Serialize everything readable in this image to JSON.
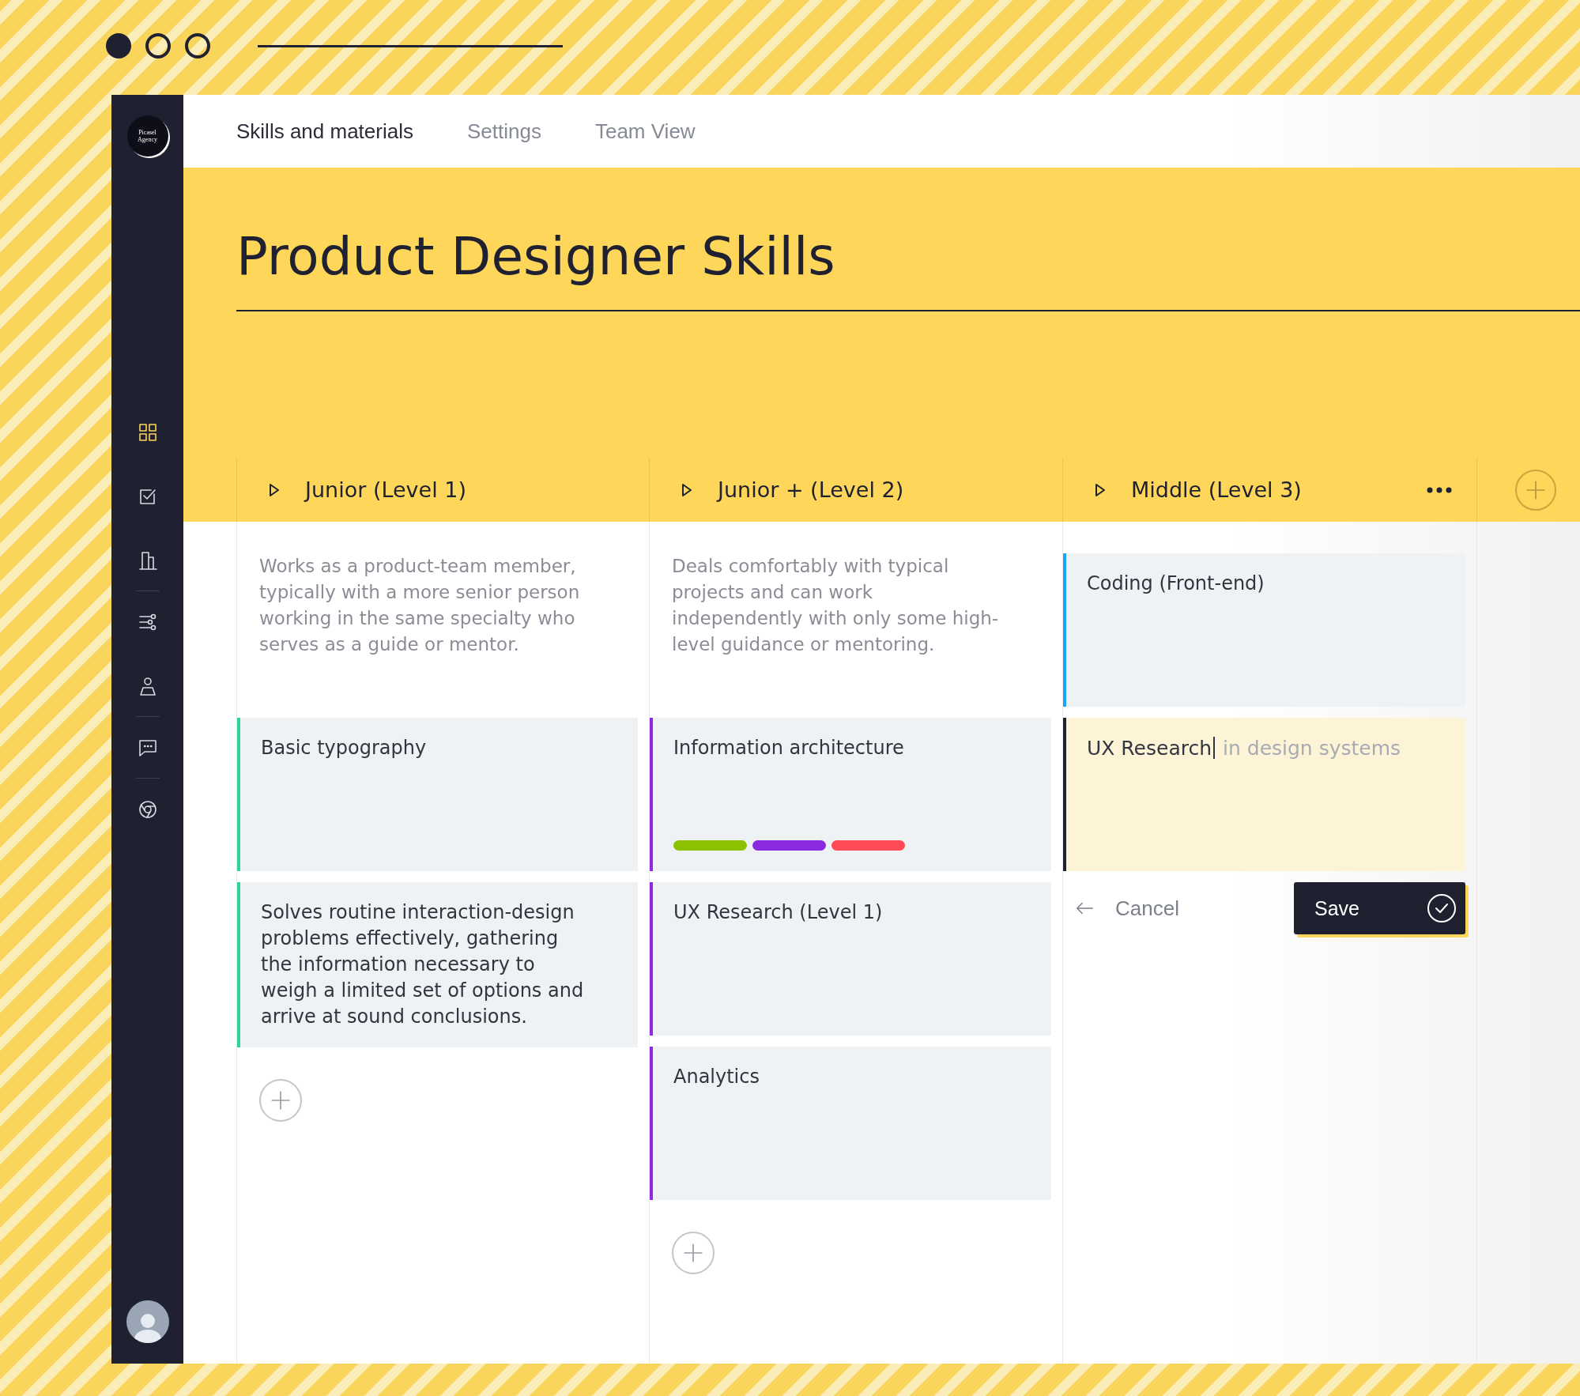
{
  "logo": "Picasel Agency",
  "tabs": [
    {
      "label": "Skills and materials",
      "selected": true
    },
    {
      "label": "Settings",
      "selected": false
    },
    {
      "label": "Team View",
      "selected": false
    }
  ],
  "sidebar": {
    "groups": [
      {
        "items": [
          {
            "selected": true
          },
          {
            "selected": false
          },
          {
            "selected": false
          }
        ]
      },
      {
        "items": [
          {
            "selected": false
          },
          {
            "selected": false
          }
        ]
      },
      {
        "items": [
          {
            "selected": false
          }
        ]
      },
      {
        "items": [
          {
            "selected": false
          }
        ]
      }
    ]
  },
  "title": "Product Designer Skills",
  "columns": [
    {
      "title": "Junior (Level 1)",
      "menu": false,
      "description": "Works as a product-team member, typically with a more senior person working in the same specialty who serves as a guide or mentor.",
      "add_button": true,
      "cards": [
        {
          "kind": "text",
          "text": "Basic typography",
          "color": "#2ed3a0"
        },
        {
          "kind": "text",
          "text": "Solves routine interaction-design problems effectively, gathering the information necessary to weigh a limited set of options and arrive at sound conclusions.",
          "color": "#2ed3a0"
        }
      ]
    },
    {
      "title": "Junior + (Level 2)",
      "menu": false,
      "description": "Deals comfortably with typical projects and can work independently with only some high-level guidance or mentoring.",
      "add_button": true,
      "cards": [
        {
          "kind": "tags",
          "text": "Information architecture",
          "color": "#8a2be2",
          "tags": [
            {
              "color": "#8cc100"
            },
            {
              "color": "#8a2be2"
            },
            {
              "color": "#ff4b55"
            }
          ]
        },
        {
          "kind": "text",
          "text": "UX Research (Level 1)",
          "color": "#8a2be2"
        },
        {
          "kind": "text",
          "text": "Analytics",
          "color": "#8a2be2"
        }
      ]
    },
    {
      "title": "Middle (Level 3)",
      "menu": true,
      "add_button": false,
      "cards": [
        {
          "kind": "text",
          "text": "Coding (Front-end)",
          "color": "#1aa7f5"
        },
        {
          "kind": "editing",
          "value": "UX Research",
          "suggestion": "in design systems",
          "color": "#1f2030"
        }
      ],
      "actions": {
        "cancel": "Cancel",
        "save": "Save"
      }
    }
  ]
}
